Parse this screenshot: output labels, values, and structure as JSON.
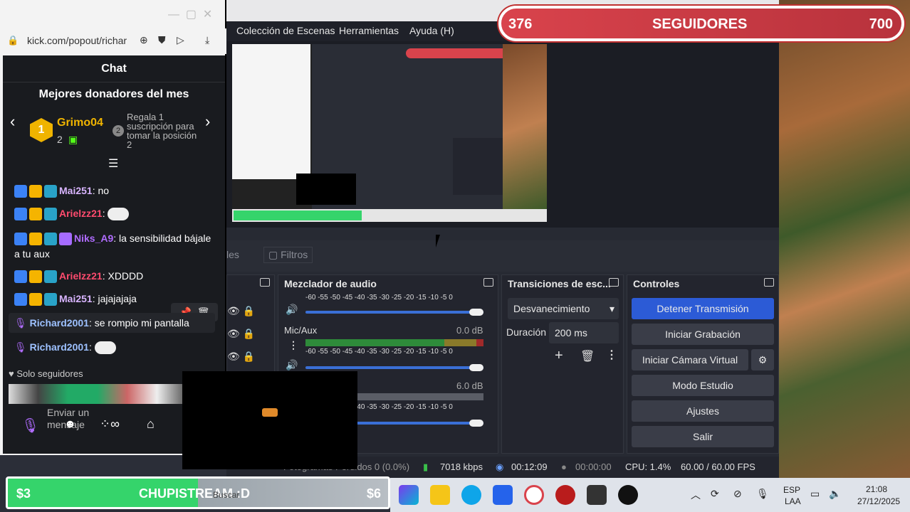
{
  "browser": {
    "url": "kick.com/popout/richar",
    "chat_title": "Chat",
    "top_donors_title": "Mejores donadores del mes",
    "donor_name": "Grimo04",
    "donor_rank": "1",
    "donor_count": "2",
    "rank2_badge": "2",
    "rank2_text": "Regala 1 suscripción para tomar la posición 2",
    "messages": [
      {
        "user": "Mai251",
        "text": "no",
        "color": "#d8b4fe"
      },
      {
        "user": "Arielzz21",
        "text": "",
        "color": "#ff4b6e"
      },
      {
        "user": "Niks_A9",
        "text": "la sensibilidad bájale a tu aux",
        "color": "#b06cff"
      },
      {
        "user": "Arielzz21",
        "text": "XDDDD",
        "color": "#ff4b6e"
      },
      {
        "user": "Mai251",
        "text": "jajajajaja",
        "color": "#d8b4fe"
      },
      {
        "user": "Richard2001",
        "text": "se rompio mi pantalla",
        "color": "#9dc1ff"
      },
      {
        "user": "Richard2001",
        "text": "",
        "color": "#9dc1ff"
      }
    ],
    "followers_only": "Solo seguidores",
    "send_placeholder": "Enviar un mensaje"
  },
  "obs": {
    "menu": [
      "Colección de Escenas",
      "Herramientas",
      "Ayuda (H)"
    ],
    "tab_scenes": "les",
    "tab_filters": "Filtros",
    "mixer_title": "Mezclador de audio",
    "scale": "-60 -55 -50 -45 -40 -35 -30 -25 -20 -15 -10 -5 0",
    "channels": [
      {
        "name": "Mic/Aux",
        "db": "0.0 dB"
      },
      {
        "name": "",
        "db": "6.0 dB"
      }
    ],
    "transitions_title": "Transiciones de esc...",
    "transition_value": "Desvanecimiento",
    "duration_label": "Duración",
    "duration_value": "200 ms",
    "controls_title": "Controles",
    "controls": [
      "Detener Transmisión",
      "Iniciar Grabación",
      "Iniciar Cámara Virtual",
      "Modo Estudio",
      "Ajustes",
      "Salir"
    ],
    "status": {
      "frames": "Fotogramas Perdidos 0 (0.0%)",
      "bitrate": "7018 kbps",
      "live_time": "00:12:09",
      "rec_time": "00:00:00",
      "cpu": "CPU: 1.4%",
      "fps": "60.00 / 60.00 FPS"
    }
  },
  "overlay": {
    "followers_current": "376",
    "followers_label": "SEGUIDORES",
    "followers_goal": "700",
    "donation_current": "$3",
    "donation_label": "CHUPISTREAM :D",
    "donation_goal": "$6"
  },
  "taskbar": {
    "search_placeholder": "Buscar",
    "lang": "ESP",
    "lang2": "LAA",
    "time": "21:08",
    "date": "27/12/2025"
  }
}
